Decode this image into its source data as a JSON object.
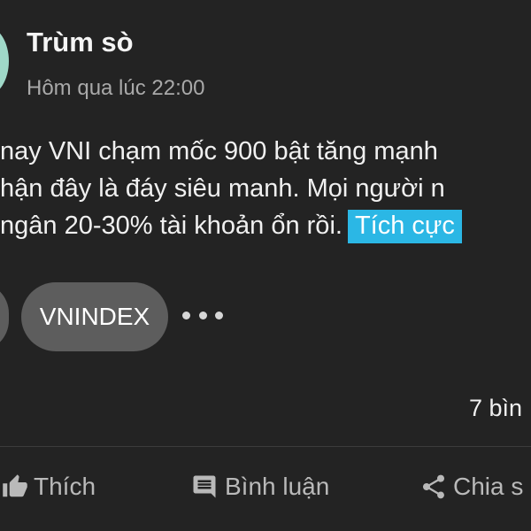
{
  "post": {
    "author": "Trùm sò",
    "timestamp": "Hôm qua lúc 22:00",
    "lines": [
      " nay VNI chạm mốc 900 bật tăng mạnh",
      "hận đây là đáy siêu manh. Mọi người n",
      "ngân 20-30% tài khoản ổn rồi."
    ],
    "sentiment_tag": "Tích cực",
    "tags": [
      "VNINDEX"
    ],
    "comment_count": "7 bìn"
  },
  "actions": {
    "like": "Thích",
    "comment": "Bình luận",
    "share": "Chia s"
  },
  "colors": {
    "background": "#232323",
    "sentiment_bg": "#2bb7e5",
    "chip_bg": "#5d5d5d",
    "muted_text": "#a9a9a9"
  },
  "icons": [
    "thumbs-up-icon",
    "comment-icon",
    "share-icon",
    "more-icon"
  ]
}
